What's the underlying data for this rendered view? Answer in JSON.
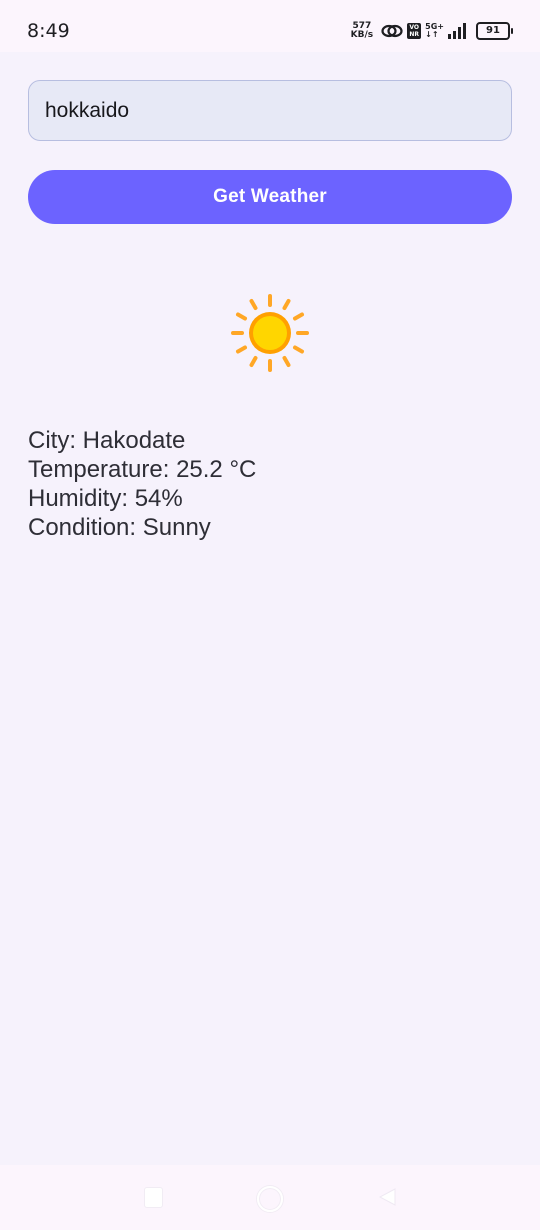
{
  "status_bar": {
    "time": "8:49",
    "net_speed_value": "577",
    "net_speed_unit": "KB/s",
    "volte_top": "VO",
    "volte_bottom": "NR",
    "network_type": "5G+",
    "network_sub": "↓↑",
    "battery": "91"
  },
  "search": {
    "value": "hokkaido",
    "placeholder": ""
  },
  "button": {
    "label": "Get Weather"
  },
  "weather": {
    "icon": "sun-icon",
    "city_line": "City: Hakodate",
    "temperature_line": "Temperature: 25.2 °C",
    "humidity_line": "Humidity: 54%",
    "condition_line": "Condition: Sunny"
  },
  "colors": {
    "accent": "#6c63ff",
    "background": "#f6f2fc",
    "input_fill": "#e7e9f6",
    "sun_core": "#ffd400",
    "sun_rays": "#ffa726"
  }
}
